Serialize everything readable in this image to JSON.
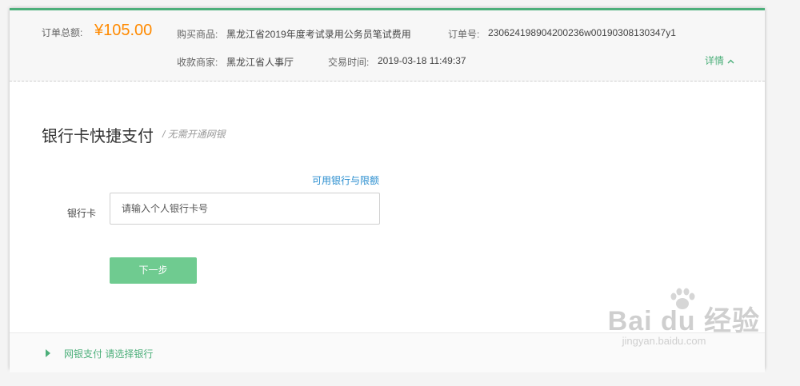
{
  "summary": {
    "total_label": "订单总额:",
    "total_value": "¥105.00",
    "product_label": "购买商品:",
    "product_value": "黑龙江省2019年度考试录用公务员笔试费用",
    "order_no_label": "订单号:",
    "order_no_value": "230624198904200236w00190308130347y1",
    "merchant_label": "收款商家:",
    "merchant_value": "黑龙江省人事厅",
    "time_label": "交易时间:",
    "time_value": "2019-03-18 11:49:37",
    "details_link": "详情",
    "details_icon": "chevron-up-icon"
  },
  "payment": {
    "title": "银行卡快捷支付",
    "subtitle": "/ 无需开通网银",
    "banks_link": "可用银行与限额",
    "card_label": "银行卡",
    "card_placeholder": "请输入个人银行卡号",
    "next_button": "下一步"
  },
  "footer": {
    "option_label": "网银支付 请选择银行",
    "option_icon": "triangle-right-icon"
  },
  "watermark": {
    "main": "Bai du 经验",
    "sub": "jingyan.baidu.com"
  },
  "colors": {
    "accent": "#4caf7a",
    "amount": "#ff8a00",
    "link": "#2a8ecf",
    "button": "#6fcb90"
  }
}
